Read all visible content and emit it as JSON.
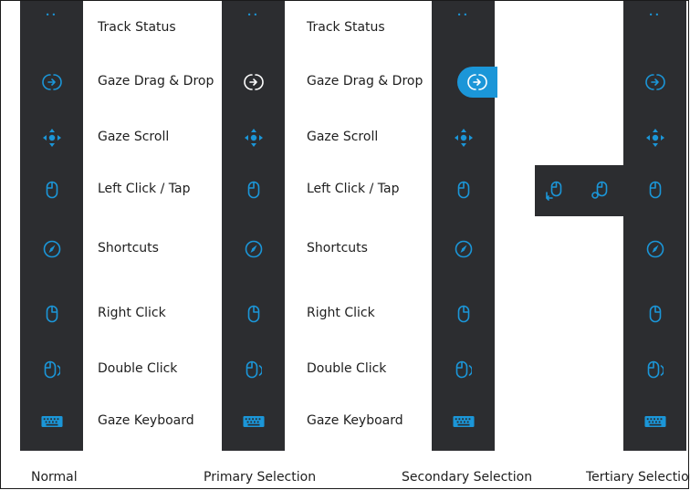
{
  "colors": {
    "panel": "#2c2d30",
    "accent": "#1b96d8",
    "selected_icon": "#ffffff",
    "text": "#1e1e1e"
  },
  "menu_items": [
    {
      "label": "Track Status",
      "icon": "track-status-icon"
    },
    {
      "label": "Gaze Drag & Drop",
      "icon": "drag-drop-icon"
    },
    {
      "label": "Gaze Scroll",
      "icon": "scroll-icon"
    },
    {
      "label": "Left Click / Tap",
      "icon": "left-click-icon"
    },
    {
      "label": "Shortcuts",
      "icon": "shortcuts-icon"
    },
    {
      "label": "Right Click",
      "icon": "right-click-icon"
    },
    {
      "label": "Double Click",
      "icon": "double-click-icon"
    },
    {
      "label": "Gaze Keyboard",
      "icon": "keyboard-icon"
    }
  ],
  "states": [
    {
      "caption": "Normal",
      "selected_item": ""
    },
    {
      "caption": "Primary Selection",
      "selected_item": "Gaze Drag & Drop"
    },
    {
      "caption": "Secondary Selection",
      "selected_item": "Gaze Drag & Drop"
    },
    {
      "caption": "Tertiary Selection",
      "selected_item": "Left Click / Tap"
    }
  ],
  "tertiary_popout": {
    "icons": [
      "left-click-drag-icon",
      "left-click-multi-icon"
    ]
  }
}
